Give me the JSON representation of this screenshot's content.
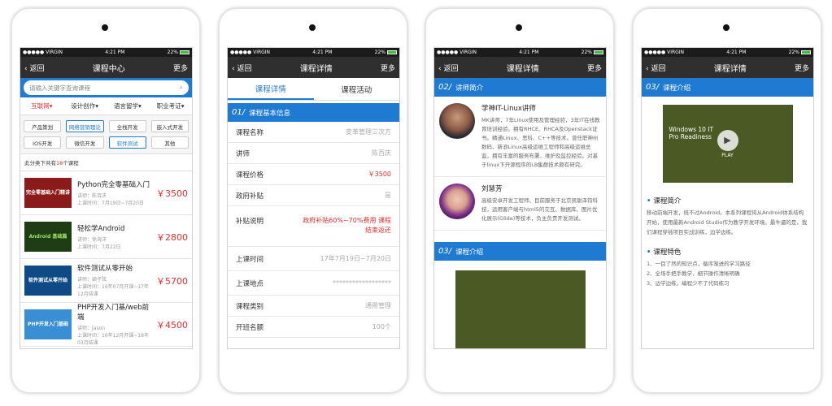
{
  "status": {
    "carrier": "●●●●● VIRGIN",
    "time": "4:21 PM",
    "battery": "22%"
  },
  "nav": {
    "back": "返回",
    "more": "更多"
  },
  "screen1": {
    "title": "课程中心",
    "search_placeholder": "请输入关键字查询课程",
    "categories": [
      "互联网▾",
      "设计创作▾",
      "语言留学▾",
      "职业考证▾"
    ],
    "tags": [
      "产品策划",
      "网络营销理论",
      "全栈开发",
      "嵌入式开发",
      "IOS开发",
      "微信开发",
      "软件测试",
      "其他"
    ],
    "count_prefix": "此分类下共有",
    "count_num": "18",
    "count_suffix": "个课程",
    "courses": [
      {
        "name": "Python完全零基础入门",
        "teacher": "讲师：陈百庆",
        "time": "上课时间：7月19日~7月20日",
        "price": "￥3500",
        "thumb": "完全零基础入门精讲"
      },
      {
        "name": "轻松学Android",
        "teacher": "讲师：徐海洋",
        "time": "上课时间：7月22日",
        "price": "￥2800",
        "thumb": "Android 基础篇"
      },
      {
        "name": "软件测试从零开始",
        "teacher": "讲师：颖子玹",
        "time": "上课时间：16年07月开课~17年12月结课",
        "price": "￥5700",
        "thumb": "软件测试从零开始"
      },
      {
        "name": "PHP开发入门基/web前端",
        "teacher": "讲师：Jason",
        "time": "上课时间：16年12月开课~18年03月结课",
        "price": "￥4500",
        "thumb": "PHP开发入门基础"
      }
    ]
  },
  "screen2": {
    "title": "课程详情",
    "tabs": [
      "课程详情",
      "课程活动"
    ],
    "section_no": "01/",
    "section_title": "课程基本信息",
    "rows": [
      {
        "label": "课程名称",
        "value": "变革管理三次方"
      },
      {
        "label": "讲师",
        "value": "陈百庆"
      },
      {
        "label": "课程价格",
        "value": "￥3500"
      },
      {
        "label": "政府补贴",
        "value": "是"
      },
      {
        "label": "补贴说明",
        "value": "政府补贴60%~70%费用 课程结束返还"
      },
      {
        "label": "上课时间",
        "value": "17年7月19日~7月20日"
      },
      {
        "label": "上课地点",
        "value": "******************"
      },
      {
        "label": "课程类别",
        "value": "通用管理"
      },
      {
        "label": "开班名额",
        "value": "100个"
      }
    ]
  },
  "screen3": {
    "title": "课程详情",
    "section_no": "02/",
    "section_title": "讲师简介",
    "teachers": [
      {
        "name": "学神IT-Linux讲师",
        "desc": "MK讲师，7年Linux使用及管理经验，3年IT在线教育培训经验。拥有RHCE、RHCA及Openstack证书。精通Linux、思科、C++等技术。曾任职神州数码、新浪Linux高级运维工程师和高级运维总监，拥有丰富的服务布署、维护及监控经验。对基于linux下开源程序的LB集群技术颇有研究。"
      },
      {
        "name": "刘慧芳",
        "desc": "高级安卓开发工程师。目前服务于北京凯聪泽钧科技，运用客户端与html5的交互、数据库、图片优化展示(Glide)等技术，负主负责开发测试。"
      }
    ],
    "section2_no": "03/",
    "section2_title": "课程介绍"
  },
  "screen4": {
    "title": "课程详情",
    "section_no": "03/",
    "section_title": "课程介绍",
    "video_text": "Windows 10 IT Pro Readiness",
    "video_play": "PLAY",
    "intro_head": "课程简介",
    "intro_text": "移动前端开发，绕不过Android。本系列课程将从Android体系结构开始，使用最新Android Studio作为教学开发环境。最牛逼的是，我们课程穿插项目实战训练，边学边练。",
    "feature_head": "课程特色",
    "features": [
      "1、一目了然的知识点，循序渐进的学习路径",
      "2、全场手把手教学，细节操作清晰明确",
      "3、边学边练，编程少不了代码练习"
    ]
  }
}
